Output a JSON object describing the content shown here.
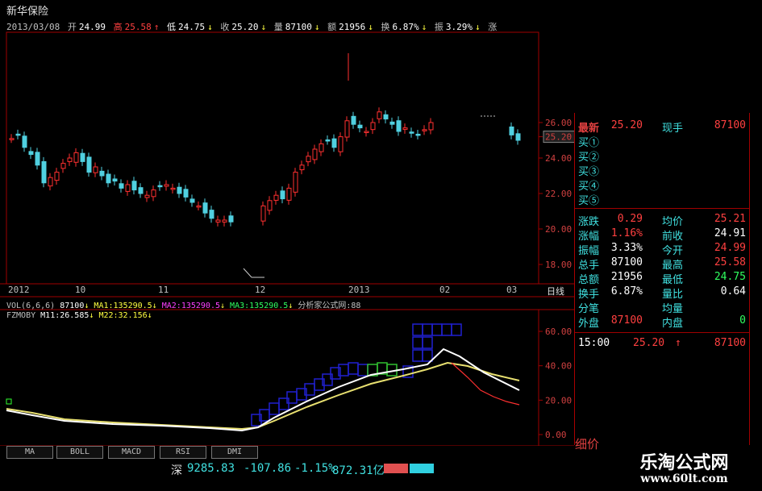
{
  "stock": {
    "name": "新华保险"
  },
  "info": {
    "date": "2013/03/08",
    "open_label": "开",
    "open": "24.99",
    "high_label": "高",
    "high": "25.58",
    "low_label": "低",
    "low": "24.75",
    "close_label": "收",
    "close": "25.20",
    "volume_label": "量",
    "volume": "87100",
    "amount_label": "额",
    "amount": "21956",
    "turnover_label": "换",
    "turnover": "6.87%",
    "amplitude_label": "振",
    "amplitude": "3.29%",
    "extra": "涨"
  },
  "price_axis": [
    "26.00",
    "25.20",
    "24.00",
    "22.00",
    "20.00",
    "18.00"
  ],
  "low_marker": "17.63",
  "x_axis": [
    "2012",
    "10",
    "11",
    "12",
    "2013",
    "02",
    "03",
    "日线"
  ],
  "vol_indicator": {
    "label": "VOL(6,6,6)",
    "v": "87100",
    "ma1": "MA1:135290.5",
    "ma2": "MA2:135290.5",
    "ma3": "MA3:135290.5",
    "arrow": "↓",
    "source": "分析家公式网:88"
  },
  "fz_indicator": {
    "label": "FZMOBY",
    "m11": "M11:26.585",
    "m22": "M22:32.156",
    "arrow": "↓"
  },
  "fz_axis": [
    "60.00",
    "40.00",
    "20.00",
    "0.00"
  ],
  "tabs": [
    "MA",
    "BOLL",
    "MACD",
    "RSI",
    "DMI"
  ],
  "index_bar": {
    "market": "深",
    "value": "9285.83",
    "change": "-107.86",
    "pct": "-1.15%",
    "amount": "872.31亿"
  },
  "quote": {
    "latest_label": "最新",
    "latest": "25.20",
    "vol_now_label": "现手",
    "vol_now": "87100",
    "buy_labels": [
      "买①",
      "买②",
      "买③",
      "买④",
      "买⑤"
    ],
    "rows": [
      {
        "l1": "涨跌",
        "v1": "0.29",
        "c1": "red",
        "l2": "均价",
        "v2": "25.21",
        "c2": "red"
      },
      {
        "l1": "涨幅",
        "v1": "1.16%",
        "c1": "red",
        "l2": "前收",
        "v2": "24.91",
        "c2": "white"
      },
      {
        "l1": "振幅",
        "v1": "3.33%",
        "c1": "white",
        "l2": "今开",
        "v2": "24.99",
        "c2": "red"
      },
      {
        "l1": "总手",
        "v1": "87100",
        "c1": "white",
        "l2": "最高",
        "v2": "25.58",
        "c2": "red"
      },
      {
        "l1": "总额",
        "v1": "21956",
        "c1": "white",
        "l2": "最低",
        "v2": "24.75",
        "c2": "green"
      },
      {
        "l1": "换手",
        "v1": "6.87%",
        "c1": "white",
        "l2": "量比",
        "v2": "0.64",
        "c2": "white"
      },
      {
        "l1": "分笔",
        "v1": "",
        "c1": "white",
        "l2": "均量",
        "v2": "",
        "c2": "white"
      },
      {
        "l1": "外盘",
        "v1": "87100",
        "c1": "red",
        "l2": "内盘",
        "v2": "0",
        "c2": "green"
      }
    ],
    "tick_time": "15:00",
    "tick_price": "25.20",
    "tick_arrow": "↑",
    "tick_vol": "87100",
    "detail_tab": "细价"
  },
  "watermark": {
    "title": "乐淘公式网",
    "url": "www.60lt.com"
  }
}
